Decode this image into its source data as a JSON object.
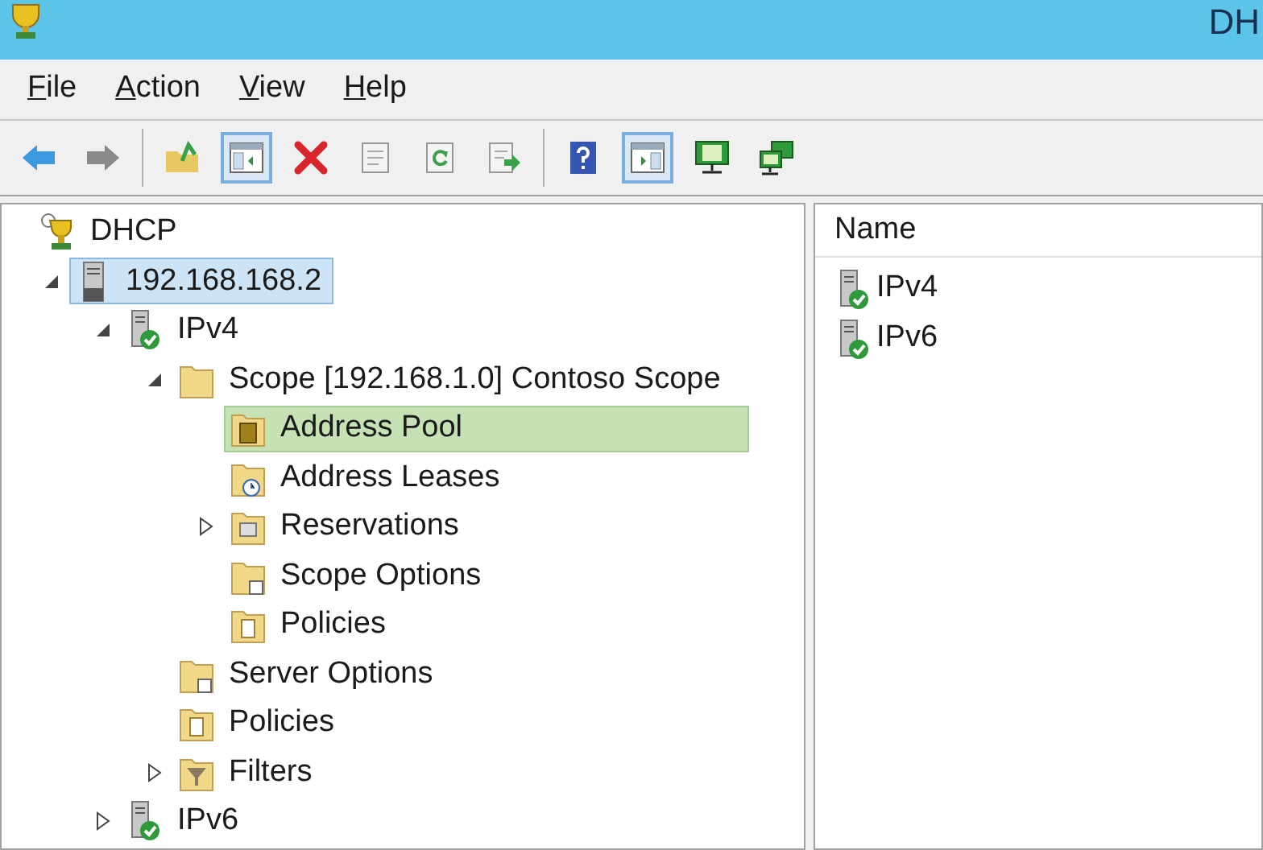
{
  "window": {
    "title": "DH"
  },
  "menu": [
    "File",
    "Action",
    "View",
    "Help"
  ],
  "toolbar": [
    {
      "kind": "back",
      "pressed": false
    },
    {
      "kind": "forward",
      "pressed": false
    },
    {
      "kind": "separator"
    },
    {
      "kind": "up-folder",
      "pressed": false
    },
    {
      "kind": "console-tree",
      "pressed": true
    },
    {
      "kind": "delete",
      "pressed": false
    },
    {
      "kind": "properties",
      "pressed": false
    },
    {
      "kind": "refresh",
      "pressed": false
    },
    {
      "kind": "export",
      "pressed": false
    },
    {
      "kind": "separator"
    },
    {
      "kind": "help",
      "pressed": false
    },
    {
      "kind": "action-pane",
      "pressed": true
    },
    {
      "kind": "server",
      "pressed": false
    },
    {
      "kind": "servers",
      "pressed": false
    }
  ],
  "tree": [
    {
      "label": "DHCP",
      "kind": "dhcp",
      "selected": false,
      "highlighted": false,
      "children": [
        {
          "label": "192.168.168.2",
          "kind": "server",
          "expanded": true,
          "selected": true,
          "highlighted": false,
          "children": [
            {
              "label": "IPv4",
              "kind": "ip",
              "expanded": true,
              "selected": false,
              "highlighted": false,
              "children": [
                {
                  "label": "Scope [192.168.1.0] Contoso Scope",
                  "kind": "folder",
                  "expanded": true,
                  "selected": false,
                  "highlighted": false,
                  "children": [
                    {
                      "label": "Address Pool",
                      "kind": "pool",
                      "selected": false,
                      "highlighted": true
                    },
                    {
                      "label": "Address Leases",
                      "kind": "leases",
                      "selected": false,
                      "highlighted": false
                    },
                    {
                      "label": "Reservations",
                      "kind": "reservations",
                      "expanded": false,
                      "selected": false,
                      "highlighted": false
                    },
                    {
                      "label": "Scope Options",
                      "kind": "options",
                      "selected": false,
                      "highlighted": false
                    },
                    {
                      "label": "Policies",
                      "kind": "policies",
                      "selected": false,
                      "highlighted": false
                    }
                  ]
                },
                {
                  "label": "Server Options",
                  "kind": "options",
                  "selected": false,
                  "highlighted": false
                },
                {
                  "label": "Policies",
                  "kind": "policies",
                  "selected": false,
                  "highlighted": false
                },
                {
                  "label": "Filters",
                  "kind": "filters",
                  "expanded": false,
                  "selected": false,
                  "highlighted": false
                }
              ]
            },
            {
              "label": "IPv6",
              "kind": "ip",
              "expanded": false,
              "selected": false,
              "highlighted": false
            }
          ]
        }
      ]
    }
  ],
  "list": {
    "columns": [
      "Name"
    ],
    "rows": [
      {
        "label": "IPv4",
        "kind": "ip"
      },
      {
        "label": "IPv6",
        "kind": "ip"
      }
    ]
  }
}
